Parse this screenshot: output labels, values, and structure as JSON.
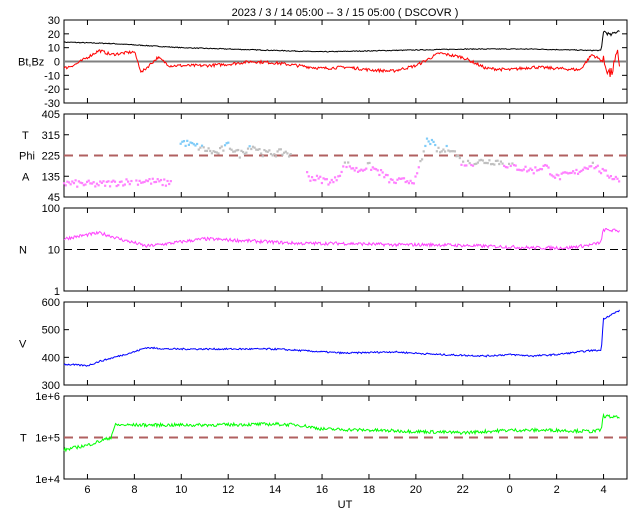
{
  "title": "2023 /  3 / 14   05:00 --  3 / 15   05:00 ( DSCOVR )",
  "chart_data": [
    {
      "type": "line",
      "ylabel": "Bt,Bz",
      "ylim": [
        -30,
        30
      ],
      "yticks": [
        "30",
        "20",
        "10",
        "0",
        "-10",
        "-20",
        "-30"
      ],
      "yticks_values": [
        30,
        20,
        10,
        0,
        -10,
        -20,
        -30
      ],
      "ref_line": 0,
      "series": [
        {
          "name": "Bt",
          "color": "#000000",
          "x_hours": [
            0,
            2,
            3,
            4,
            5,
            7,
            9,
            11,
            14,
            17,
            20,
            22.5,
            22.9,
            23.0,
            23.3,
            23.7
          ],
          "values": [
            14,
            13,
            12,
            11,
            10,
            9,
            8,
            7,
            8,
            9,
            9,
            8,
            8,
            22,
            19,
            23
          ]
        },
        {
          "name": "Bz",
          "color": "#ff0000",
          "x_hours": [
            0,
            0.5,
            1,
            1.5,
            2,
            3,
            3.3,
            4,
            4.5,
            6,
            7,
            8,
            9,
            10,
            11,
            12,
            13,
            14,
            15,
            16,
            17,
            18,
            19,
            20,
            21,
            22,
            22.5,
            23,
            23.3,
            23.6,
            23.7
          ],
          "values": [
            -5,
            -2,
            3,
            8,
            5,
            7,
            -8,
            3,
            -3,
            -3,
            -2,
            0,
            -1,
            -3,
            -5,
            -4,
            -6,
            -7,
            -3,
            6,
            3,
            -5,
            -6,
            -4,
            -5,
            -6,
            5,
            0,
            -10,
            5,
            -3
          ]
        }
      ]
    },
    {
      "type": "scatter",
      "ylabels": [
        "T",
        "Phi",
        "A"
      ],
      "ylim": [
        45,
        405
      ],
      "yticks": [
        "405",
        "315",
        "225",
        "135",
        "45"
      ],
      "yticks_values": [
        405,
        315,
        225,
        135,
        45
      ],
      "ref_line": 225,
      "colors": {
        "toward": "#80ccf8",
        "mixed": "#c0c0c0",
        "away": "#ff80ff"
      },
      "series": [
        {
          "name": "Phi",
          "x_hours": [
            0,
            1.5,
            2.5,
            3.5,
            4.5,
            5,
            5.8,
            6.5,
            7,
            7.5,
            8,
            8.5,
            9,
            9.5,
            10.5,
            11.5,
            12,
            12.5,
            13,
            13.5,
            14,
            15,
            15.5,
            16,
            16.5,
            17,
            17.8,
            18.5,
            19,
            20,
            20.5,
            21,
            21.8,
            22.5,
            23,
            23.7
          ],
          "values": [
            105,
            100,
            110,
            115,
            105,
            285,
            260,
            235,
            270,
            230,
            270,
            235,
            235,
            240,
            130,
            110,
            190,
            160,
            180,
            150,
            110,
            120,
            300,
            240,
            260,
            190,
            200,
            200,
            180,
            160,
            180,
            130,
            150,
            190,
            150,
            120
          ]
        }
      ]
    },
    {
      "type": "line",
      "ylabel": "N",
      "yscale": "log",
      "ylim": [
        1,
        100
      ],
      "yticks": [
        "100",
        "10",
        "1"
      ],
      "yticks_values": [
        100,
        10,
        1
      ],
      "ref_line": 10,
      "series": [
        {
          "name": "N",
          "color": "#ff40ff",
          "x_hours": [
            0,
            1.5,
            2.5,
            3.5,
            4.5,
            6,
            8,
            10,
            12,
            14,
            16,
            18,
            20,
            21.5,
            22.5,
            22.9,
            23.0,
            23.7
          ],
          "values": [
            18,
            25,
            17,
            12,
            14,
            18,
            16,
            14,
            14,
            13,
            13,
            12,
            11,
            11,
            13,
            15,
            30,
            28
          ]
        }
      ]
    },
    {
      "type": "line",
      "ylabel": "V",
      "ylim": [
        300,
        600
      ],
      "yticks": [
        "600",
        "500",
        "400",
        "300"
      ],
      "yticks_values": [
        600,
        500,
        400,
        300
      ],
      "series": [
        {
          "name": "V",
          "color": "#0000ff",
          "x_hours": [
            0,
            1,
            1.5,
            3,
            3.5,
            4.5,
            6,
            9,
            11,
            12,
            14,
            16,
            18,
            19,
            20,
            21,
            22.5,
            22.9,
            23,
            23.7
          ],
          "values": [
            375,
            370,
            385,
            420,
            435,
            430,
            430,
            430,
            420,
            415,
            420,
            410,
            405,
            410,
            405,
            410,
            425,
            425,
            540,
            570
          ]
        }
      ]
    },
    {
      "type": "line",
      "ylabel": "T",
      "yscale": "log",
      "ylim": [
        10000,
        1000000
      ],
      "yticks": [
        "1e+6",
        "1e+5",
        "1e+4"
      ],
      "yticks_values": [
        1000000,
        100000,
        10000
      ],
      "ref_line": 100000,
      "series": [
        {
          "name": "T",
          "color": "#00ff00",
          "x_hours": [
            0,
            1,
            1.5,
            2,
            2.2,
            4,
            6,
            9,
            10,
            11,
            13,
            15,
            17,
            19,
            21,
            22.5,
            22.9,
            23,
            23.7
          ],
          "values": [
            50000,
            65000,
            80000,
            100000,
            200000,
            200000,
            200000,
            210000,
            200000,
            160000,
            150000,
            140000,
            130000,
            150000,
            150000,
            140000,
            150000,
            330000,
            300000
          ]
        }
      ]
    }
  ],
  "xaxis": {
    "label": "UT",
    "start_hour": 5,
    "span_hours": 24,
    "tick_labels": [
      "6",
      "8",
      "10",
      "12",
      "14",
      "16",
      "18",
      "20",
      "22",
      "0",
      "2",
      "4"
    ],
    "tick_offsets_hours": [
      1,
      3,
      5,
      7,
      9,
      11,
      13,
      15,
      17,
      19,
      21,
      23
    ]
  },
  "ref_colors": {
    "zero": "#808080",
    "dash_brown": "#b06060",
    "dash_black": "#000000"
  }
}
